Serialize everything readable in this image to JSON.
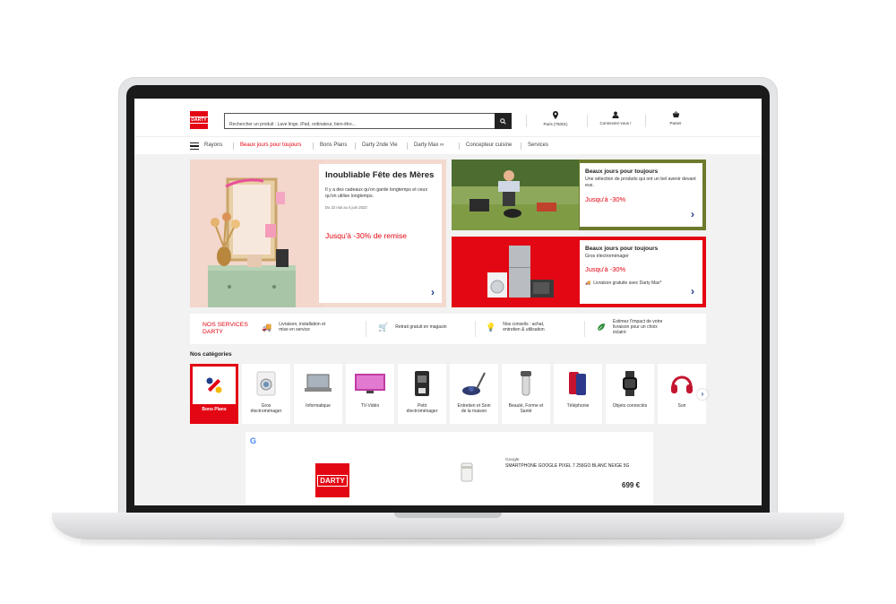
{
  "header": {
    "logo_text": "DARTY",
    "search_placeholder": "Rechercher un produit : Lave linge, iPad, ordinateur, bien-être...",
    "store": "Paris (75001)",
    "account": "Connectez-vous !",
    "cart": "Panier"
  },
  "nav": {
    "menu_label": "Rayons",
    "items": [
      "Beaux jours pour toujours",
      "Bons Plans",
      "Darty 2nde Vie",
      "Darty Max",
      "Concepteur cuisine",
      "Services"
    ]
  },
  "hero": {
    "title": "Inoubliable Fête des Mères",
    "text": "Il y a des cadeaux qu'on garde longtemps et ceux qu'on utilise longtemps.",
    "date": "Du 22 mai au 4 juin 2023",
    "promo": "Jusqu'à -30% de remise"
  },
  "banner1": {
    "title": "Beaux jours pour toujours",
    "text": "Une sélection de produits qui ont un bel avenir devant eux.",
    "promo": "Jusqu'à -30%"
  },
  "banner2": {
    "title": "Beaux jours pour toujours",
    "subtitle": "Gros électroménager",
    "promo": "Jusqu'à -30%",
    "shipping": "Livraison gratuite avec Darty Max*"
  },
  "services": {
    "title_line1": "NOS SERVICES",
    "title_line2": "DARTY",
    "items": [
      {
        "line1": "Livraison, installation et",
        "line2": "mise en service"
      },
      {
        "line1": "Retrait gratuit en magasin",
        "line2": ""
      },
      {
        "line1": "Nos conseils : achat,",
        "line2": "entretien & utilisation"
      },
      {
        "line1": "Estimez l'impact de votre",
        "line2": "livraison pour un choix",
        "line3": "éclairé"
      }
    ]
  },
  "categories": {
    "title": "Nos catégories",
    "items": [
      {
        "line1": "Bons Plans",
        "line2": ""
      },
      {
        "line1": "Gros",
        "line2": "électroménager"
      },
      {
        "line1": "Informatique",
        "line2": ""
      },
      {
        "line1": "TV-Vidéo",
        "line2": ""
      },
      {
        "line1": "Petit",
        "line2": "électroménager"
      },
      {
        "line1": "Entretien et Soin",
        "line2": "de la maison"
      },
      {
        "line1": "Beauté, Forme et",
        "line2": "Santé"
      },
      {
        "line1": "Téléphonie",
        "line2": ""
      },
      {
        "line1": "Objets connectés",
        "line2": ""
      },
      {
        "line1": "Son",
        "line2": ""
      }
    ]
  },
  "ad": {
    "google_mark": "G",
    "logo_text": "DARTY",
    "brand": "Google",
    "product": "SMARTPHONE GOOGLE PIXEL 7 256GO BLANC NEIGE 5G",
    "price": "699 €"
  },
  "colors": {
    "brand_red": "#e30613",
    "arrow_blue": "#1f3c88",
    "banner_green": "#6b7a2c"
  }
}
